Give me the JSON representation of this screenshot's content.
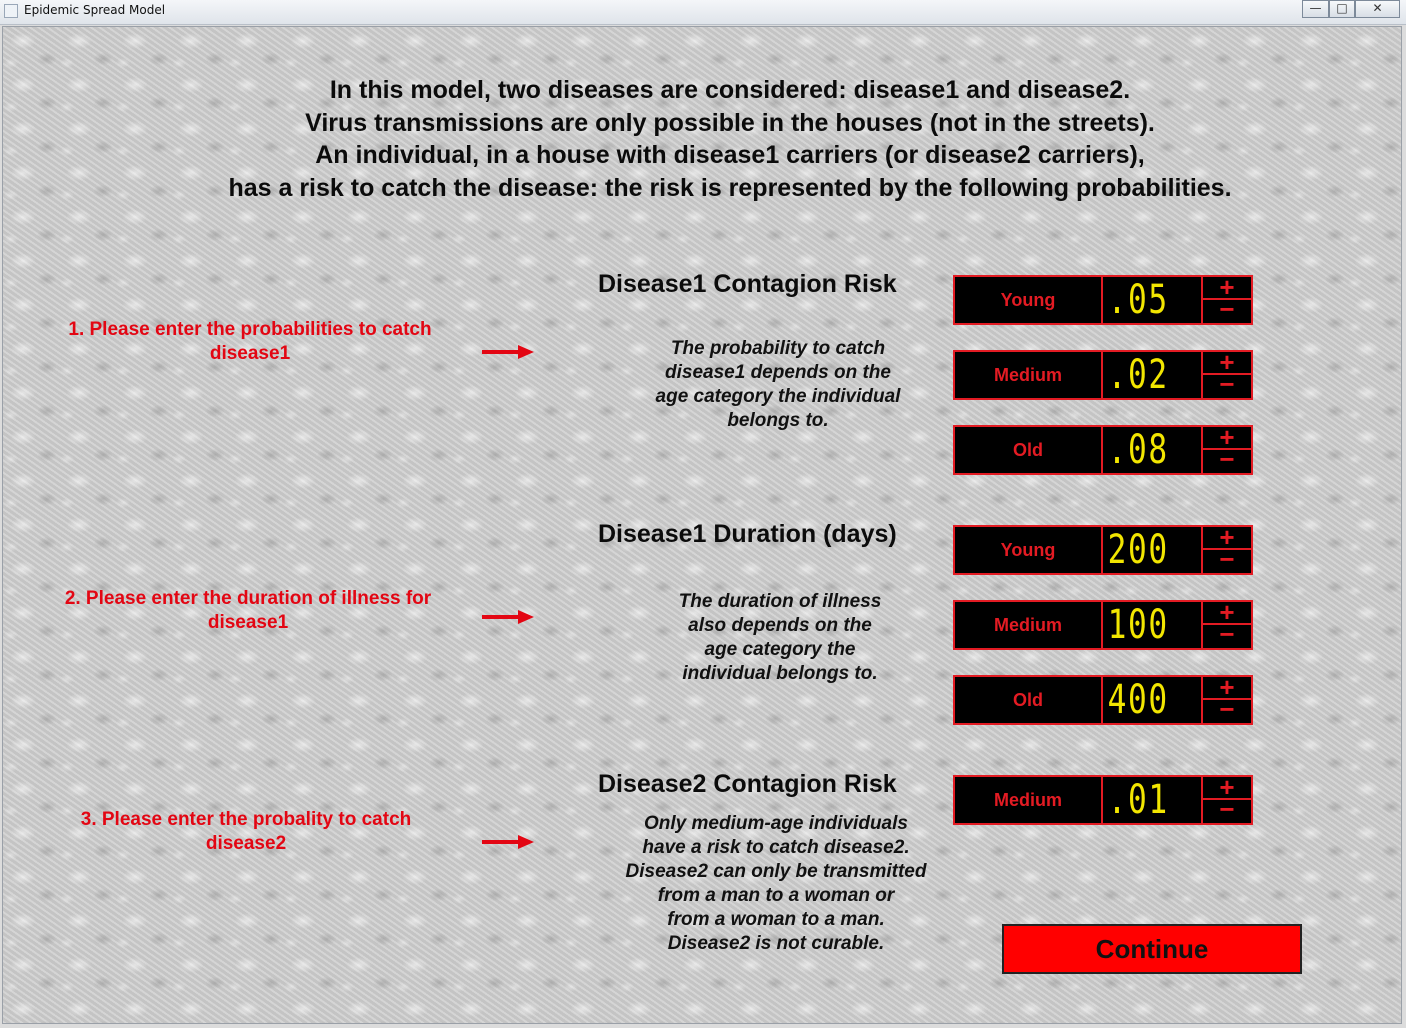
{
  "window": {
    "title": "Epidemic Spread Model",
    "minimize": "—",
    "maximize": "□",
    "close": "✕"
  },
  "intro": {
    "line1": "In this model, two diseases are considered: disease1 and disease2.",
    "line2": "Virus transmissions are only possible in the houses (not in the streets).",
    "line3": "An individual, in a house with disease1 carriers (or disease2 carriers),",
    "line4": "has a risk to catch the disease: the risk is represented by the following probabilities."
  },
  "sections": [
    {
      "instruction_line1": "1. Please enter the probabilities to catch",
      "instruction_line2": "disease1",
      "title": "Disease1 Contagion Risk",
      "desc": [
        "The probability to catch",
        "disease1 depends on the",
        "age category the individual",
        "belongs to."
      ],
      "rows": [
        {
          "label": "Young",
          "value": ".05"
        },
        {
          "label": "Medium",
          "value": ".02"
        },
        {
          "label": "Old",
          "value": ".08"
        }
      ]
    },
    {
      "instruction_line1": "2. Please enter the duration of illness for",
      "instruction_line2": "disease1",
      "title": "Disease1 Duration (days)",
      "desc": [
        "The duration of illness",
        "also depends on the",
        "age category the",
        "individual belongs to."
      ],
      "rows": [
        {
          "label": "Young",
          "value": "200"
        },
        {
          "label": "Medium",
          "value": "100"
        },
        {
          "label": "Old",
          "value": "400"
        }
      ]
    },
    {
      "instruction_line1": "3. Please enter the probality to catch",
      "instruction_line2": "disease2",
      "title": "Disease2 Contagion Risk",
      "desc": [
        "Only medium-age individuals",
        "have a risk to catch disease2.",
        "Disease2 can only be transmitted",
        "from a man to a woman or",
        "from a woman to a man.",
        "Disease2 is not curable."
      ],
      "rows": [
        {
          "label": "Medium",
          "value": ".01"
        }
      ]
    }
  ],
  "spinner": {
    "plus": "+",
    "minus": "−"
  },
  "continue_label": "Continue",
  "colors": {
    "accent": "#e31b23",
    "digits": "#f2e600",
    "instruction": "#e30613",
    "button": "#ff0000"
  },
  "icons": {
    "arrow": "right-arrow-icon"
  }
}
